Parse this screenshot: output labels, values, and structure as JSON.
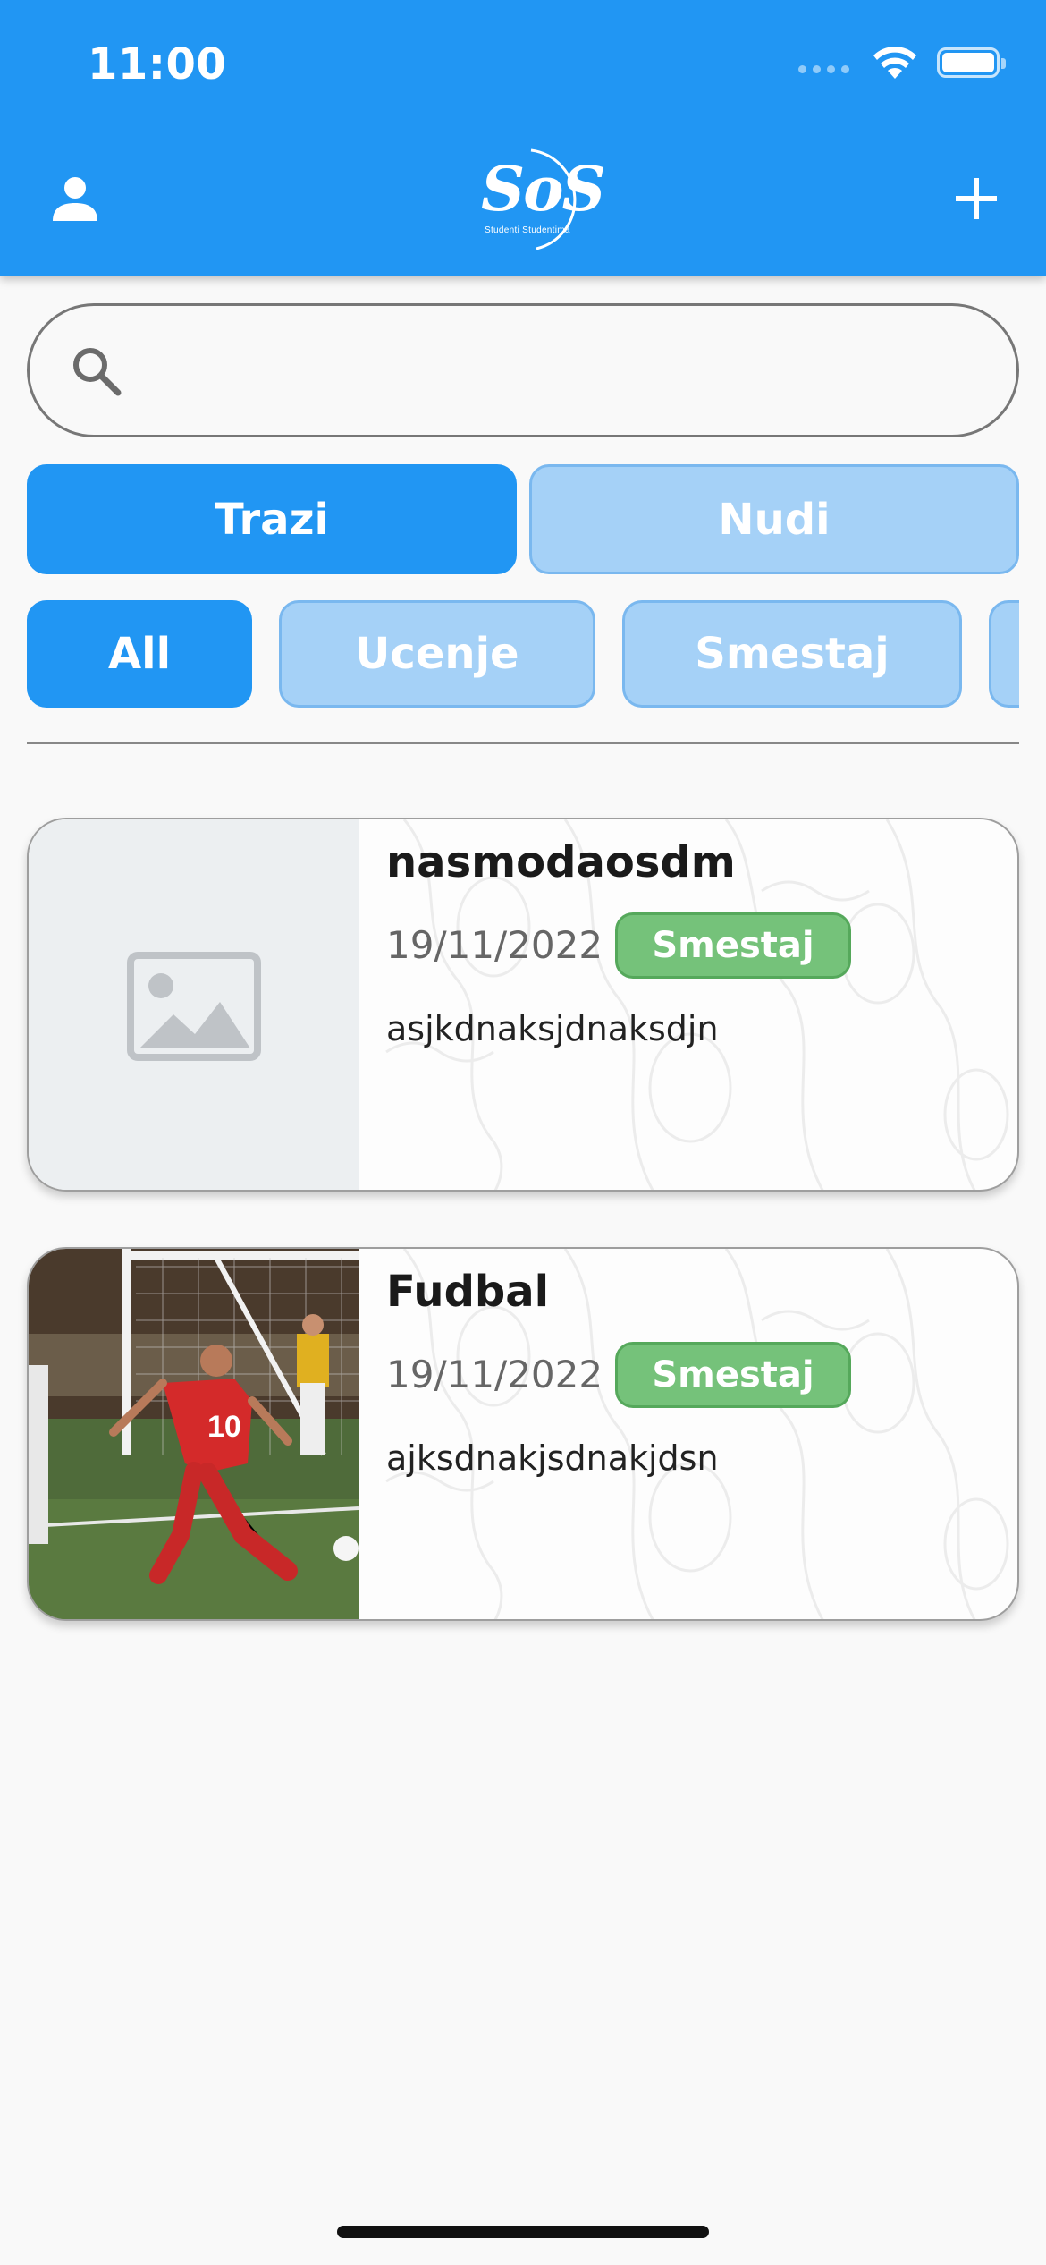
{
  "status_bar": {
    "time": "11:00"
  },
  "header": {
    "logo_text": "SoS",
    "logo_subtitle": "Studenti Studentima",
    "profile_icon": "person-icon",
    "add_icon": "plus-icon",
    "color": "#2196f3"
  },
  "search": {
    "value": "",
    "placeholder": "",
    "icon": "search-icon"
  },
  "mode_tabs": [
    {
      "label": "Trazi",
      "active": true
    },
    {
      "label": "Nudi",
      "active": false
    }
  ],
  "categories": [
    {
      "label": "All",
      "active": true
    },
    {
      "label": "Ucenje",
      "active": false
    },
    {
      "label": "Smestaj",
      "active": false
    },
    {
      "label": "",
      "active": false
    }
  ],
  "posts": [
    {
      "title": "nasmodaosdm",
      "date": "19/11/2022",
      "category": "Smestaj",
      "description": "asjkdnaksjdnaksdjn",
      "image": "image-placeholder-icon"
    },
    {
      "title": "Fudbal",
      "date": "19/11/2022",
      "category": "Smestaj",
      "description": "ajksdnakjsdnakjdsn",
      "image": "soccer-player-photo"
    }
  ],
  "colors": {
    "accent": "#2196f3",
    "inactive": "#a5d1f7",
    "badge": "#75c27a"
  }
}
